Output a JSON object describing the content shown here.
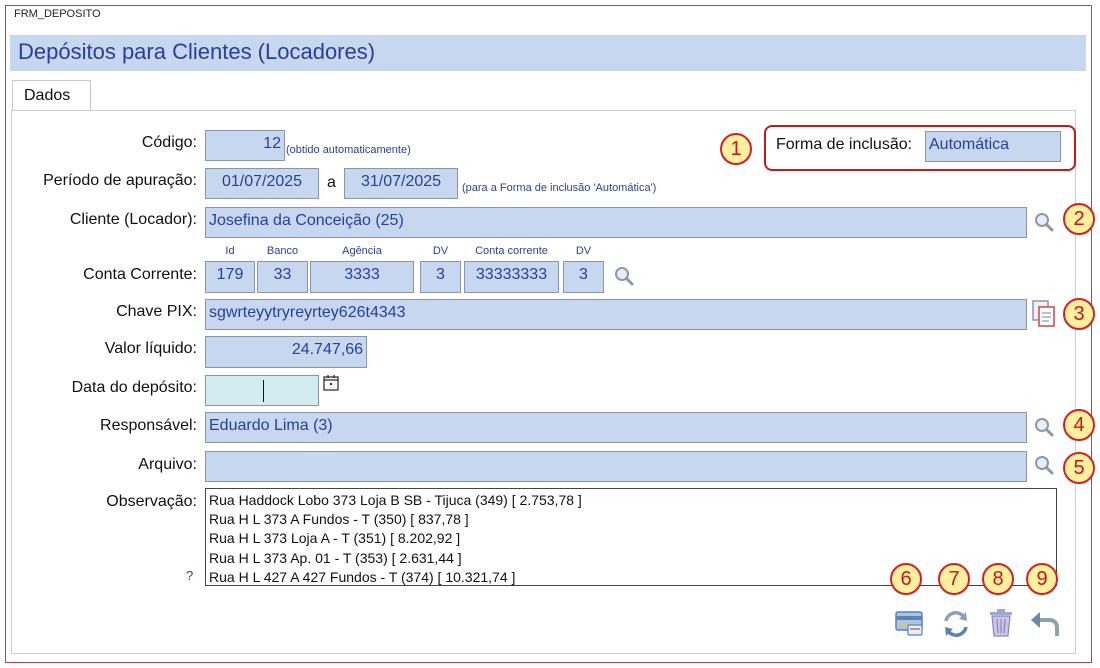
{
  "window": {
    "title": "FRM_DEPOSITO"
  },
  "header": {
    "title": "Depósitos para Clientes (Locadores)"
  },
  "tabs": [
    {
      "label": "Dados"
    }
  ],
  "form": {
    "codigo": {
      "label": "Código:",
      "value": "12",
      "note": "(obtido automaticamente)"
    },
    "periodo": {
      "label": "Período de apuração:",
      "from": "01/07/2025",
      "sep": "a",
      "to": "31/07/2025",
      "note": "(para a Forma de inclusão 'Automática')"
    },
    "forma": {
      "label": "Forma de inclusão:",
      "value": "Automática"
    },
    "cliente": {
      "label": "Cliente (Locador):",
      "value": "Josefina da Conceição (25)"
    },
    "conta": {
      "label": "Conta Corrente:",
      "headers": {
        "id": "Id",
        "banco": "Banco",
        "agencia": "Agência",
        "dv1": "DV",
        "conta": "Conta corrente",
        "dv2": "DV"
      },
      "values": {
        "id": "179",
        "banco": "33",
        "agencia": "3333",
        "dv1": "3",
        "conta": "33333333",
        "dv2": "3"
      }
    },
    "pix": {
      "label": "Chave PIX:",
      "value": "sgwrteyytryreyrtey626t4343"
    },
    "valor": {
      "label": "Valor líquido:",
      "value": "24.747,66"
    },
    "data_deposito": {
      "label": "Data do depósito:",
      "value": ""
    },
    "responsavel": {
      "label": "Responsável:",
      "value": "Eduardo Lima (3)"
    },
    "arquivo": {
      "label": "Arquivo:",
      "value": ""
    },
    "observacao": {
      "label": "Observação:",
      "help": "?",
      "lines": [
        "Rua Haddock Lobo 373 Loja B  SB - Tijuca (349) [ 2.753,78 ]",
        "Rua H L 373 A Fundos - T (350) [ 837,78 ]",
        "Rua H L 373 Loja A - T (351) [ 8.202,92 ]",
        "Rua H L 373 Ap. 01 - T (353) [ 2.631,44 ]",
        "Rua H L 427 A 427 Fundos - T (374) [ 10.321,74 ]"
      ]
    }
  },
  "badges": [
    "1",
    "2",
    "3",
    "4",
    "5",
    "6",
    "7",
    "8",
    "9"
  ],
  "icons": {
    "search": "magnifier-icon",
    "copy": "clipboard-copy-icon",
    "calendar": "calendar-icon",
    "actions": [
      "payment-card-icon",
      "refresh-icon",
      "trash-icon",
      "undo-icon"
    ]
  },
  "colors": {
    "field_bg": "#c6d7ef",
    "accent_text": "#2a3f9a",
    "badge_border": "#d42020",
    "badge_bg": "#ffef9e",
    "date_bg": "#d3ecf0"
  }
}
